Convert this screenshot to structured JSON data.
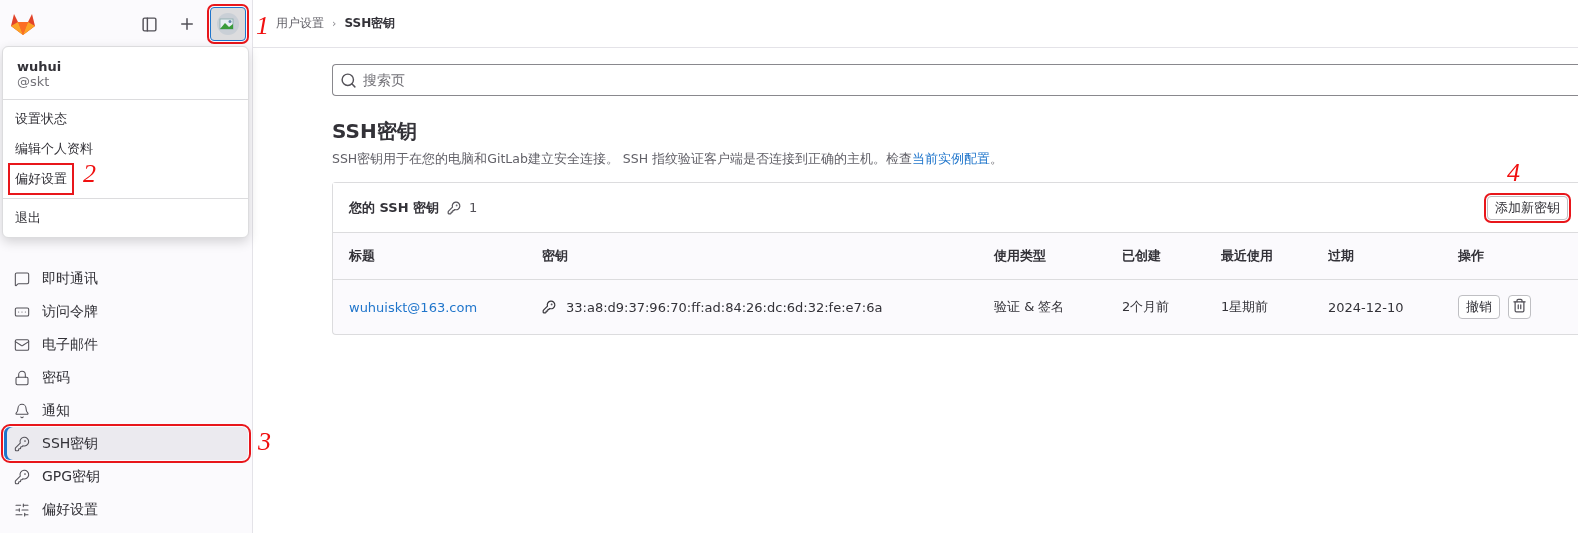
{
  "top_bar": {
    "avatar": {
      "annotation": "1"
    },
    "breadcrumb": [
      "用户设置",
      "SSH密钥"
    ],
    "breadcrumb_separator": "›"
  },
  "user_menu": {
    "name": "wuhui",
    "handle": "@skt",
    "groups": [
      [
        {
          "label": "设置状态"
        },
        {
          "label": "编辑个人资料"
        },
        {
          "label": "偏好设置",
          "annotation": "2"
        }
      ],
      [
        {
          "label": "退出"
        }
      ]
    ]
  },
  "sidebar": {
    "items": [
      {
        "label": "即时通讯",
        "selected": false
      },
      {
        "label": "访问令牌",
        "selected": false
      },
      {
        "label": "电子邮件",
        "selected": false
      },
      {
        "label": "密码",
        "selected": false
      },
      {
        "label": "通知",
        "selected": false
      },
      {
        "label": "SSH密钥",
        "selected": true,
        "annotation": "3"
      },
      {
        "label": "GPG密钥",
        "selected": false
      },
      {
        "label": "偏好设置",
        "selected": false
      }
    ]
  },
  "search": {
    "placeholder": "搜索页"
  },
  "page": {
    "title": "SSH密钥",
    "description": "SSH密钥用于在您的电脑和GitLab建立安全连接。 SSH 指纹验证客户端是否连接到正确的主机。检查",
    "description_link": "当前实例配置",
    "description_end": "。"
  },
  "keys_card": {
    "title": "您的 SSH 密钥",
    "count": "1",
    "add_button": {
      "label": "添加新密钥",
      "annotation": "4"
    },
    "columns": [
      "标题",
      "密钥",
      "使用类型",
      "已创建",
      "最近使用",
      "过期",
      "操作"
    ],
    "rows": [
      {
        "title": "wuhuiskt@163.com",
        "fingerprint": "33:a8:d9:37:96:70:ff:ad:84:26:dc:6d:32:fe:e7:6a",
        "usage": "验证 & 签名",
        "created": "2个月前",
        "last_used": "1星期前",
        "expires": "2024-12-10",
        "revoke": "撤销"
      }
    ]
  }
}
